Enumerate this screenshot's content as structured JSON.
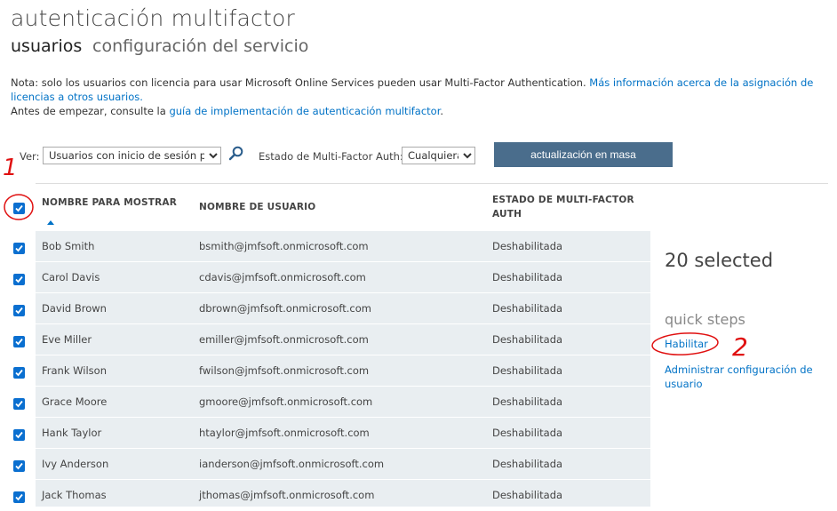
{
  "header": {
    "title": "autenticación multifactor",
    "tabs": [
      {
        "label": "usuarios",
        "active": true
      },
      {
        "label": "configuración del servicio",
        "active": false
      }
    ]
  },
  "notes": {
    "line1_text": "Nota: solo los usuarios con licencia para usar Microsoft Online Services pueden usar Multi-Factor Authentication. ",
    "line1_link": "Más información acerca de la asignación de licencias a otros usuarios.",
    "line2_text": "Antes de empezar, consulte la ",
    "line2_link": "guía de implementación de autenticación multifactor",
    "line2_end": "."
  },
  "filters": {
    "view_label": "Ver:",
    "view_value": "Usuarios con inicio de sesión permitido",
    "mfa_label": "Estado de Multi-Factor Auth:",
    "mfa_value": "Cualquiera",
    "bulk_button": "actualización en masa"
  },
  "table": {
    "columns": [
      "NOMBRE PARA MOSTRAR",
      "NOMBRE DE USUARIO",
      "ESTADO DE MULTI-FACTOR AUTH"
    ],
    "rows": [
      {
        "name": "Bob Smith",
        "username": "bsmith@jmfsoft.onmicrosoft.com",
        "status": "Deshabilitada",
        "checked": true
      },
      {
        "name": "Carol Davis",
        "username": "cdavis@jmfsoft.onmicrosoft.com",
        "status": "Deshabilitada",
        "checked": true
      },
      {
        "name": "David Brown",
        "username": "dbrown@jmfsoft.onmicrosoft.com",
        "status": "Deshabilitada",
        "checked": true
      },
      {
        "name": "Eve Miller",
        "username": "emiller@jmfsoft.onmicrosoft.com",
        "status": "Deshabilitada",
        "checked": true
      },
      {
        "name": "Frank Wilson",
        "username": "fwilson@jmfsoft.onmicrosoft.com",
        "status": "Deshabilitada",
        "checked": true
      },
      {
        "name": "Grace Moore",
        "username": "gmoore@jmfsoft.onmicrosoft.com",
        "status": "Deshabilitada",
        "checked": true
      },
      {
        "name": "Hank Taylor",
        "username": "htaylor@jmfsoft.onmicrosoft.com",
        "status": "Deshabilitada",
        "checked": true
      },
      {
        "name": "Ivy Anderson",
        "username": "ianderson@jmfsoft.onmicrosoft.com",
        "status": "Deshabilitada",
        "checked": true
      },
      {
        "name": "Jack Thomas",
        "username": "jthomas@jmfsoft.onmicrosoft.com",
        "status": "Deshabilitada",
        "checked": true
      }
    ]
  },
  "side_panel": {
    "selected_count": "20 selected",
    "quick_steps_title": "quick steps",
    "enable_link": "Habilitar",
    "manage_link": "Administrar configuración de usuario"
  },
  "annotations": {
    "mark_1": "1",
    "mark_2": "2",
    "color": "#e01010"
  },
  "colors": {
    "accent": "#0072c6",
    "button": "#4a6d8c",
    "checkbox": "#0a6fd0",
    "row_bg": "#e9eef1"
  }
}
